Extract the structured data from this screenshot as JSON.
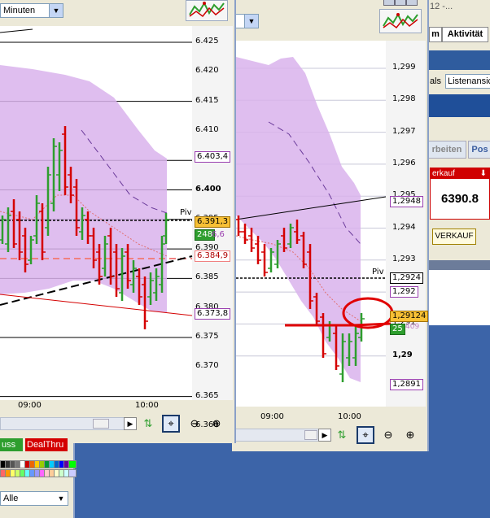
{
  "left_window": {
    "timeframe_select": "Minuten",
    "y_ticks": [
      "6.425",
      "6.420",
      "6.415",
      "6.410",
      "6.405",
      "6.400",
      "6.395",
      "6.390",
      "6.385",
      "6.380",
      "6.375",
      "6.370",
      "6.365",
      "6.360"
    ],
    "x_ticks": [
      "09:00",
      "10:00"
    ],
    "price_boxes": [
      "6.403,4",
      "6.391,3",
      "248",
      "6,6",
      "6.384,9",
      "6.373,8"
    ],
    "piv_label": "Piv",
    "buttons": [
      "uss",
      "DealThru"
    ],
    "filter_select": "Alle"
  },
  "right_window": {
    "y_ticks": [
      "1,299",
      "1,298",
      "1,297",
      "1,296",
      "1,295",
      "1,294",
      "1,293",
      "1,292",
      "1,291",
      "1,29"
    ],
    "x_ticks": [
      "09:00",
      "10:00"
    ],
    "price_boxes": [
      "1,2948",
      "1,2924",
      "1,292",
      "1,29124",
      "25",
      "409",
      "1,2891"
    ],
    "piv_label": "Piv"
  },
  "background_app": {
    "title_fragment": "12 -...",
    "tabs": [
      "m",
      "Aktivität"
    ],
    "label_als": "als",
    "label_listenansicht": "Listenansic",
    "tab_arbeiten": "rbeiten",
    "tab_pos": "Pos",
    "verkauf_header": "erkauf",
    "price": "6390.8",
    "verkauf_button": "VERKAUF"
  },
  "colors": {
    "band": "#d9b3ec",
    "up": "#2e9e2e",
    "down": "#d40000",
    "accent_red": "#e00000"
  }
}
